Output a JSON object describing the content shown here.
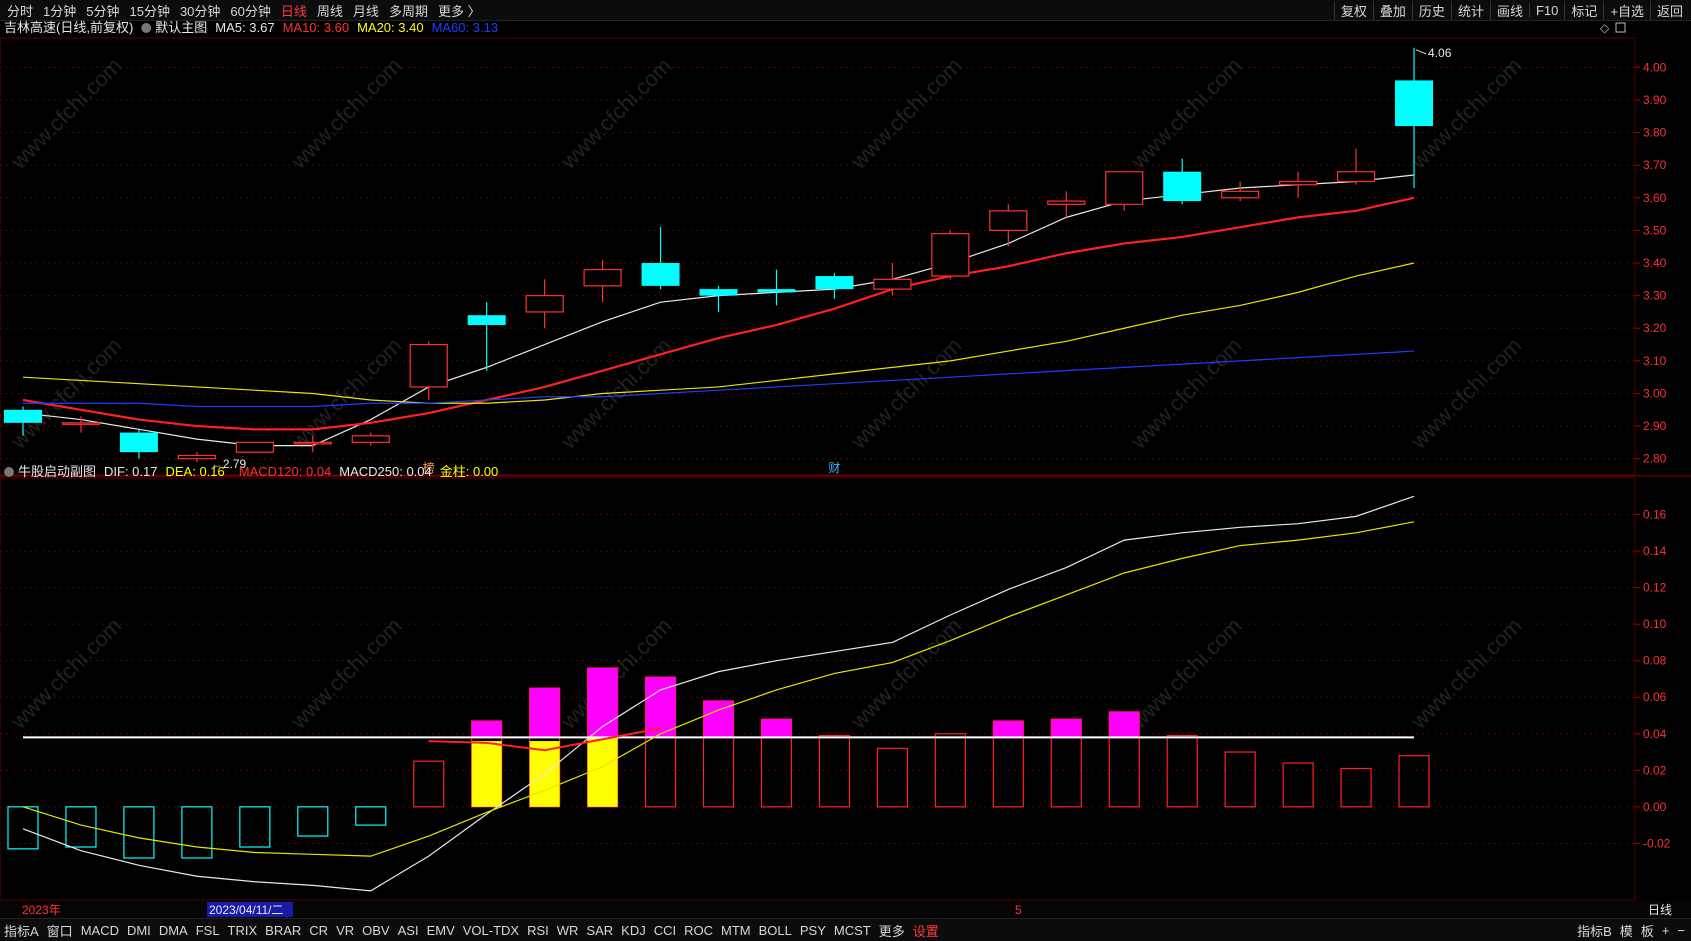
{
  "toolbar": {
    "periods": [
      "分时",
      "1分钟",
      "5分钟",
      "15分钟",
      "30分钟",
      "60分钟",
      "日线",
      "周线",
      "月线",
      "多周期",
      "更多 〉"
    ],
    "active_period": "日线",
    "tools": [
      "复权",
      "叠加",
      "历史",
      "统计",
      "画线",
      "F10",
      "标记",
      "+自选",
      "返回"
    ]
  },
  "main_legend": {
    "stock": "吉林高速(日线,前复权)",
    "template": "默认主图",
    "items": [
      {
        "text": "MA5: 3.67",
        "color": "#e8e8e8"
      },
      {
        "text": "MA10: 3.60",
        "color": "#ff3030"
      },
      {
        "text": "MA20: 3.40",
        "color": "#ffff00"
      },
      {
        "text": "MA60: 3.13",
        "color": "#1e3cff"
      }
    ]
  },
  "sub_legend": {
    "name": "牛股启动副图",
    "items": [
      {
        "text": "DIF: 0.17",
        "color": "#e8e8e8"
      },
      {
        "text": "DEA: 0.16",
        "color": "#ffff00"
      },
      {
        "text": "MACD120: 0.04",
        "color": "#ff3030"
      },
      {
        "text": "MACD250: 0.04",
        "color": "#e8e8e8"
      },
      {
        "text": "金柱: 0.00",
        "color": "#ffff00"
      }
    ]
  },
  "markers": {
    "bang": "榜",
    "cai": "财"
  },
  "x_axis": {
    "year_label": "2023年",
    "cursor_date": "2023/04/11/二",
    "month_label": "5",
    "period_label": "日线"
  },
  "bottom": {
    "indicators": [
      "指标A",
      "窗口",
      "MACD",
      "DMI",
      "DMA",
      "FSL",
      "TRIX",
      "BRAR",
      "CR",
      "VR",
      "OBV",
      "ASI",
      "EMV",
      "VOL-TDX",
      "RSI",
      "WR",
      "SAR",
      "KDJ",
      "CCI",
      "ROC",
      "MTM",
      "BOLL",
      "PSY",
      "MCST",
      "更多",
      "设置"
    ],
    "right": [
      "指标B",
      "模",
      "板",
      "+",
      "−"
    ]
  },
  "watermark": "www.cfchi.com",
  "colors": {
    "up": "#ff3030",
    "down": "#00ffff",
    "ma5": "#e8e8e8",
    "ma10": "#ff2020",
    "ma20": "#e6e600",
    "ma60": "#1e3cff",
    "magenta": "#ff00ff",
    "gold": "#ffff00",
    "grid": "#5a0000"
  },
  "chart_data": [
    {
      "type": "candlestick",
      "title": "吉林高速(日线,前复权)",
      "ylim": [
        2.75,
        4.09
      ],
      "yticks": [
        2.8,
        2.9,
        3.0,
        3.1,
        3.2,
        3.3,
        3.4,
        3.5,
        3.6,
        3.7,
        3.8,
        3.9,
        4.0
      ],
      "candles": [
        {
          "o": 2.95,
          "h": 2.96,
          "l": 2.87,
          "c": 2.91
        },
        {
          "o": 2.91,
          "h": 2.93,
          "l": 2.88,
          "c": 2.91
        },
        {
          "o": 2.88,
          "h": 2.89,
          "l": 2.8,
          "c": 2.82
        },
        {
          "o": 2.8,
          "h": 2.82,
          "l": 2.79,
          "c": 2.81
        },
        {
          "o": 2.82,
          "h": 2.85,
          "l": 2.82,
          "c": 2.85
        },
        {
          "o": 2.85,
          "h": 2.87,
          "l": 2.82,
          "c": 2.85
        },
        {
          "o": 2.85,
          "h": 2.88,
          "l": 2.84,
          "c": 2.87
        },
        {
          "o": 3.02,
          "h": 3.16,
          "l": 2.98,
          "c": 3.15
        },
        {
          "o": 3.24,
          "h": 3.28,
          "l": 3.07,
          "c": 3.21
        },
        {
          "o": 3.25,
          "h": 3.35,
          "l": 3.2,
          "c": 3.3
        },
        {
          "o": 3.33,
          "h": 3.41,
          "l": 3.28,
          "c": 3.38
        },
        {
          "o": 3.4,
          "h": 3.51,
          "l": 3.32,
          "c": 3.33
        },
        {
          "o": 3.32,
          "h": 3.33,
          "l": 3.25,
          "c": 3.3
        },
        {
          "o": 3.32,
          "h": 3.38,
          "l": 3.27,
          "c": 3.31
        },
        {
          "o": 3.36,
          "h": 3.37,
          "l": 3.29,
          "c": 3.32
        },
        {
          "o": 3.32,
          "h": 3.4,
          "l": 3.3,
          "c": 3.35
        },
        {
          "o": 3.36,
          "h": 3.5,
          "l": 3.35,
          "c": 3.49
        },
        {
          "o": 3.5,
          "h": 3.58,
          "l": 3.45,
          "c": 3.56
        },
        {
          "o": 3.58,
          "h": 3.62,
          "l": 3.54,
          "c": 3.59
        },
        {
          "o": 3.58,
          "h": 3.68,
          "l": 3.56,
          "c": 3.68
        },
        {
          "o": 3.68,
          "h": 3.72,
          "l": 3.58,
          "c": 3.59
        },
        {
          "o": 3.6,
          "h": 3.65,
          "l": 3.59,
          "c": 3.62
        },
        {
          "o": 3.64,
          "h": 3.68,
          "l": 3.6,
          "c": 3.65
        },
        {
          "o": 3.65,
          "h": 3.75,
          "l": 3.64,
          "c": 3.68
        },
        {
          "o": 3.96,
          "h": 4.06,
          "l": 3.63,
          "c": 3.82
        }
      ],
      "series": [
        {
          "name": "MA5",
          "values": [
            2.94,
            2.92,
            2.89,
            2.86,
            2.84,
            2.84,
            2.92,
            3.02,
            3.08,
            3.15,
            3.22,
            3.28,
            3.3,
            3.31,
            3.32,
            3.35,
            3.4,
            3.46,
            3.54,
            3.59,
            3.61,
            3.63,
            3.64,
            3.65,
            3.67
          ]
        },
        {
          "name": "MA10",
          "values": [
            2.98,
            2.95,
            2.92,
            2.9,
            2.89,
            2.89,
            2.91,
            2.94,
            2.98,
            3.02,
            3.07,
            3.12,
            3.17,
            3.21,
            3.26,
            3.32,
            3.36,
            3.39,
            3.43,
            3.46,
            3.48,
            3.51,
            3.54,
            3.56,
            3.6
          ]
        },
        {
          "name": "MA20",
          "values": [
            3.05,
            3.04,
            3.03,
            3.02,
            3.01,
            3.0,
            2.98,
            2.97,
            2.97,
            2.98,
            3.0,
            3.01,
            3.02,
            3.04,
            3.06,
            3.08,
            3.1,
            3.13,
            3.16,
            3.2,
            3.24,
            3.27,
            3.31,
            3.36,
            3.4
          ]
        },
        {
          "name": "MA60",
          "values": [
            2.97,
            2.97,
            2.97,
            2.96,
            2.96,
            2.96,
            2.97,
            2.97,
            2.98,
            2.99,
            2.99,
            3.0,
            3.01,
            3.02,
            3.03,
            3.04,
            3.05,
            3.06,
            3.07,
            3.08,
            3.09,
            3.1,
            3.11,
            3.12,
            3.13
          ]
        }
      ],
      "annotations": [
        {
          "label": "4.06",
          "candle": 24,
          "value": 4.06
        },
        {
          "label": "2.79",
          "candle": 3,
          "value": 2.79
        }
      ]
    },
    {
      "type": "bar",
      "title": "牛股启动副图",
      "ylim": [
        -0.051,
        0.18
      ],
      "yticks": [
        -0.02,
        0.0,
        0.02,
        0.04,
        0.06,
        0.08,
        0.1,
        0.12,
        0.14,
        0.16
      ],
      "series": [
        {
          "name": "MACD",
          "values": [
            -0.023,
            -0.022,
            -0.028,
            -0.028,
            -0.022,
            -0.016,
            -0.01,
            0.025,
            0.047,
            0.065,
            0.076,
            0.071,
            0.058,
            0.048,
            0.039,
            0.032,
            0.04,
            0.047,
            0.048,
            0.052,
            0.039,
            0.03,
            0.024,
            0.021,
            0.028
          ]
        },
        {
          "name": "金柱",
          "values": [
            0,
            0,
            0,
            0,
            0,
            0,
            0,
            0,
            0.036,
            0.036,
            0.038,
            0,
            0,
            0,
            0,
            0,
            0,
            0,
            0,
            0,
            0,
            0,
            0,
            0,
            0
          ]
        },
        {
          "name": "DIF",
          "values": [
            -0.012,
            -0.024,
            -0.032,
            -0.038,
            -0.041,
            -0.043,
            -0.046,
            -0.027,
            -0.004,
            0.018,
            0.044,
            0.064,
            0.074,
            0.08,
            0.085,
            0.09,
            0.105,
            0.119,
            0.131,
            0.146,
            0.15,
            0.153,
            0.155,
            0.159,
            0.17
          ]
        },
        {
          "name": "DEA",
          "values": [
            0.0,
            -0.01,
            -0.017,
            -0.022,
            -0.025,
            -0.026,
            -0.027,
            -0.016,
            -0.003,
            0.009,
            0.022,
            0.04,
            0.053,
            0.064,
            0.073,
            0.079,
            0.091,
            0.104,
            0.116,
            0.128,
            0.136,
            0.143,
            0.146,
            0.15,
            0.156
          ]
        },
        {
          "name": "MACD120",
          "values": [
            null,
            null,
            null,
            null,
            null,
            null,
            null,
            0.036,
            0.035,
            0.031,
            0.037,
            0.043,
            null,
            null,
            null,
            null,
            null,
            null,
            null,
            null,
            null,
            null,
            null,
            null,
            null
          ]
        }
      ],
      "reference_line": 0.038
    }
  ]
}
